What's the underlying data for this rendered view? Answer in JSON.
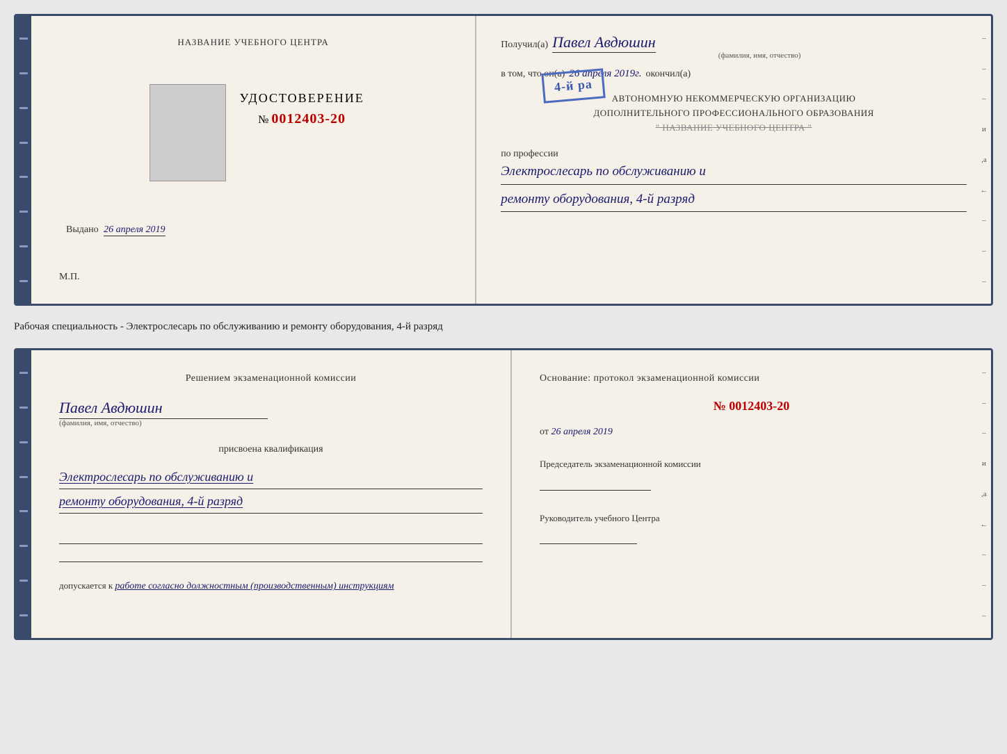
{
  "cert1": {
    "left": {
      "title": "НАЗВАНИЕ УЧЕБНОГО ЦЕНТРА",
      "doc_label": "УДОСТОВЕРЕНИЕ",
      "doc_number_prefix": "№",
      "doc_number": "0012403-20",
      "issued_label": "Выдано",
      "issued_date": "26 апреля 2019",
      "mp_label": "М.П."
    },
    "right": {
      "received_label": "Получил(а)",
      "recipient_name": "Павел Авдюшин",
      "fio_label": "(фамилия, имя, отчество)",
      "vtom_label": "в том, что он(а)",
      "completion_date": "26 апреля 2019г.",
      "finished_label": "окончил(а)",
      "stamp_text": "4-й ра",
      "org_line1": "АВТОНОМНУЮ НЕКОММЕРЧЕСКУЮ ОРГАНИЗАЦИЮ",
      "org_line2": "ДОПОЛНИТЕЛЬНОГО ПРОФЕССИОНАЛЬНОГО ОБРАЗОВАНИЯ",
      "org_name": "\" НАЗВАНИЕ УЧЕБНОГО ЦЕНТРА \"",
      "profession_label": "по профессии",
      "profession_line1": "Электрослесарь по обслуживанию и",
      "profession_line2": "ремонту оборудования, 4-й разряд"
    }
  },
  "caption": {
    "text": "Рабочая специальность - Электрослесарь по обслуживанию и ремонту оборудования, 4-й разряд"
  },
  "cert2": {
    "left": {
      "decision_title": "Решением экзаменационной комиссии",
      "name": "Павел Авдюшин",
      "fio_label": "(фамилия, имя, отчество)",
      "assigned_label": "присвоена квалификация",
      "qual_line1": "Электрослесарь по обслуживанию и",
      "qual_line2": "ремонту оборудования, 4-й разряд",
      "admission_label": "допускается к",
      "admission_text": "работе согласно должностным (производственным) инструкциям"
    },
    "right": {
      "osnov_text": "Основание: протокол экзаменационной комиссии",
      "number_prefix": "№",
      "number": "0012403-20",
      "date_prefix": "от",
      "date": "26 апреля 2019",
      "chairman_label": "Председатель экзаменационной комиссии",
      "director_label": "Руководитель учебного Центра"
    }
  },
  "decorations": {
    "right_ticks": [
      "–",
      "–",
      "–",
      "и",
      ",а",
      "←",
      "–",
      "–",
      "–"
    ],
    "right_ticks2": [
      "–",
      "–",
      "–",
      "и",
      ",а",
      "←",
      "–",
      "–",
      "–"
    ]
  }
}
